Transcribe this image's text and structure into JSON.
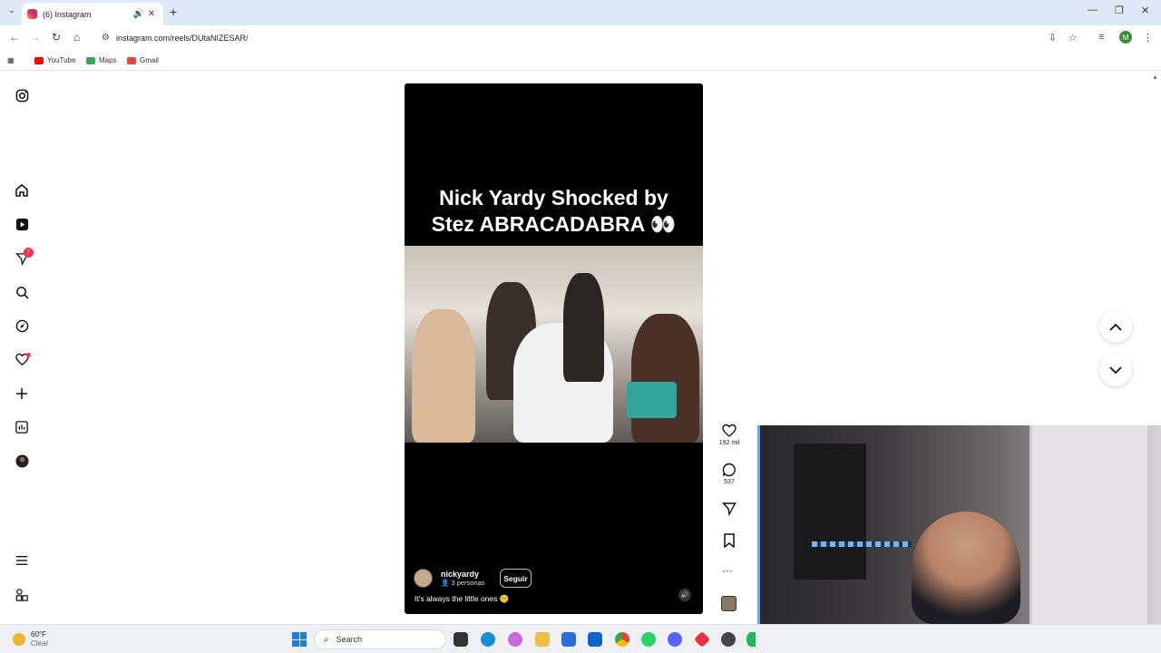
{
  "browser": {
    "tab_title": "(6) Instagram",
    "url": "instagram.com/reels/DUtaNIZESAR/",
    "bookmarks": [
      {
        "label": "YouTube",
        "color": "#ff0000"
      },
      {
        "label": "Maps",
        "color": "#34a853"
      },
      {
        "label": "Gmail",
        "color": "#ea4335"
      }
    ],
    "profile_initial": "M"
  },
  "sidebar": {
    "notification_count": "7",
    "icons": [
      "instagram-icon",
      "home-icon",
      "reels-icon",
      "messages-icon",
      "search-icon",
      "explore-icon",
      "notifications-icon",
      "create-icon",
      "dashboard-icon",
      "profile-avatar",
      "menu-icon",
      "more-apps-icon"
    ]
  },
  "reel": {
    "title_line1": "Nick Yardy Shocked by",
    "title_line2": "Stez ABRACADABRA 👀",
    "username": "nickyardy",
    "people": "3 personas",
    "follow_label": "Seguir",
    "caption": "It's always the little ones 🤫"
  },
  "actions": {
    "likes": "192 mil",
    "comments": "537"
  },
  "taskbar": {
    "temperature": "60°F",
    "condition": "Clear",
    "search_placeholder": "Search"
  },
  "colors": {
    "accent": "#ff3040",
    "windows_blue": "#1a7fe0",
    "tab_bar": "#dfe9f8"
  }
}
